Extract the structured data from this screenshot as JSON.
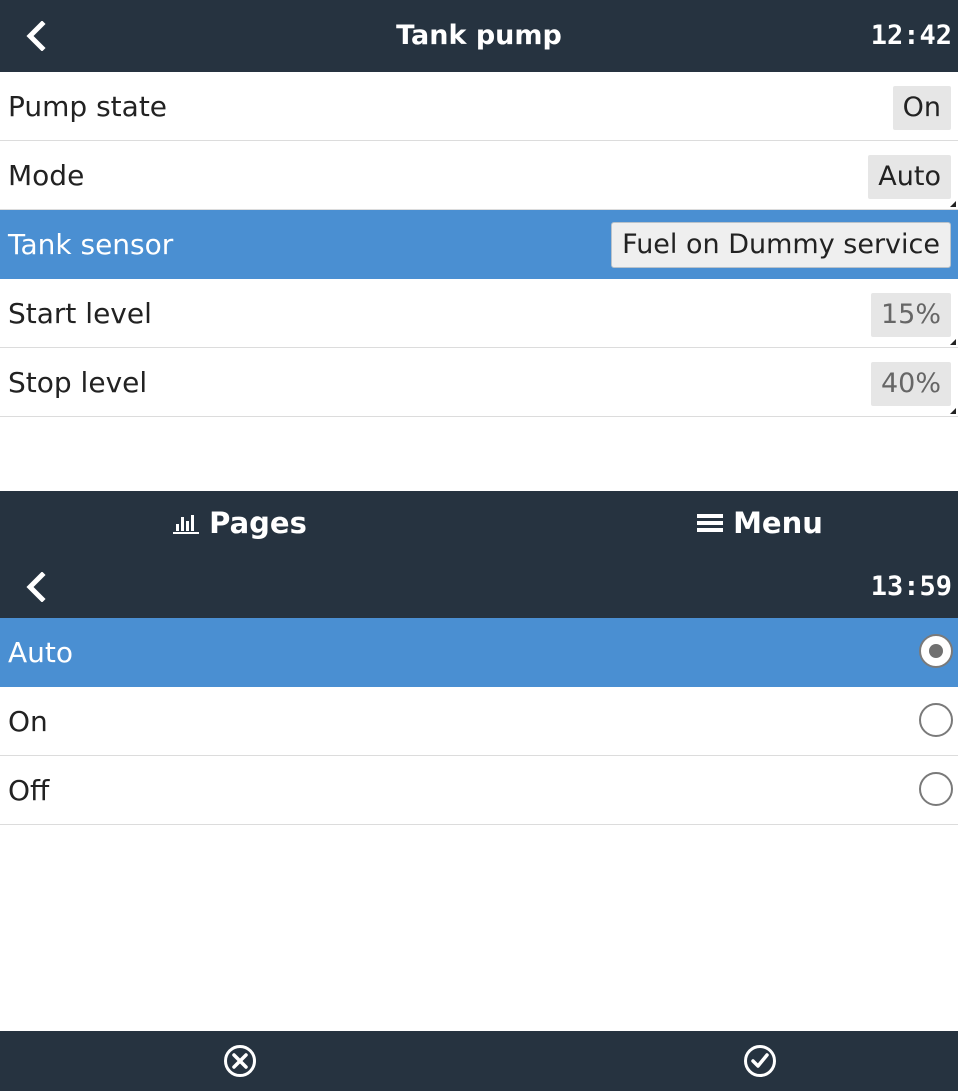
{
  "screen1": {
    "header": {
      "title": "Tank pump",
      "time": "12:42"
    },
    "rows": [
      {
        "label": "Pump state",
        "value": "On"
      },
      {
        "label": "Mode",
        "value": "Auto"
      },
      {
        "label": "Tank sensor",
        "value": "Fuel on Dummy service"
      },
      {
        "label": "Start level",
        "value": "15%"
      },
      {
        "label": "Stop level",
        "value": "40%"
      }
    ],
    "footer": {
      "pages_label": "Pages",
      "menu_label": "Menu"
    }
  },
  "screen2": {
    "header": {
      "title": "",
      "time": "13:59"
    },
    "options": [
      {
        "label": "Auto",
        "selected": true
      },
      {
        "label": "On",
        "selected": false
      },
      {
        "label": "Off",
        "selected": false
      }
    ]
  },
  "icons": {
    "back": "chevron-left-icon",
    "pages": "bar-chart-icon",
    "menu": "hamburger-menu-icon",
    "cancel": "circle-x-icon",
    "confirm": "circle-check-icon"
  },
  "colors": {
    "header_bg": "#263340",
    "selection": "#4a8fd2",
    "row_divider": "#dcdcdc"
  }
}
